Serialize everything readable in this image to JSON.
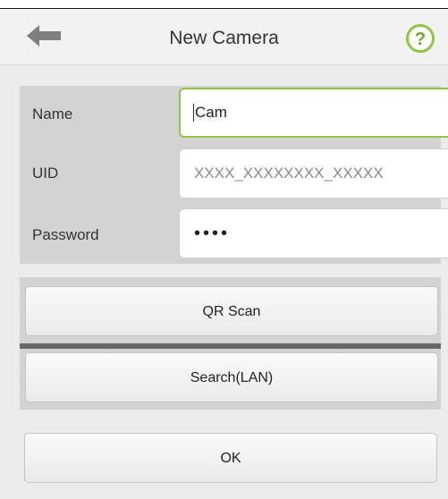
{
  "header": {
    "title": "New Camera",
    "back_icon": "back-arrow-icon",
    "help_icon": "question-mark-icon",
    "help_color": "#8dc63f"
  },
  "form": {
    "name_label": "Name",
    "name_value": "Cam",
    "uid_label": "UID",
    "uid_placeholder": "XXXX_XXXXXXXX_XXXXX",
    "password_label": "Password",
    "password_value": "••••"
  },
  "buttons": {
    "qr_scan": "QR Scan",
    "search_lan": "Search(LAN)",
    "ok": "OK"
  },
  "colors": {
    "accent": "#8dc63f",
    "panel": "#d3d3d3",
    "background": "#ebebeb"
  }
}
